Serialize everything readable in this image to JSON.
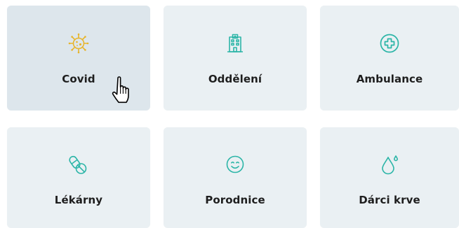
{
  "colors": {
    "tile_background": "#eaf0f3",
    "tile_hover_background": "#dde6ec",
    "icon_teal": "#2bb5a7",
    "icon_covid_yellow": "#e7b52d",
    "label_text": "#1e1e1e"
  },
  "tiles": [
    {
      "label": "Covid",
      "icon": "virus-icon",
      "hovered": true
    },
    {
      "label": "Oddělení",
      "icon": "hospital-building-icon",
      "hovered": false
    },
    {
      "label": "Ambulance",
      "icon": "medical-cross-icon",
      "hovered": false
    },
    {
      "label": "Lékárny",
      "icon": "pills-icon",
      "hovered": false
    },
    {
      "label": "Porodnice",
      "icon": "smiley-face-icon",
      "hovered": false
    },
    {
      "label": "Dárci krve",
      "icon": "blood-drop-icon",
      "hovered": false
    }
  ],
  "cursor": {
    "icon": "hand-pointer-cursor-icon"
  }
}
